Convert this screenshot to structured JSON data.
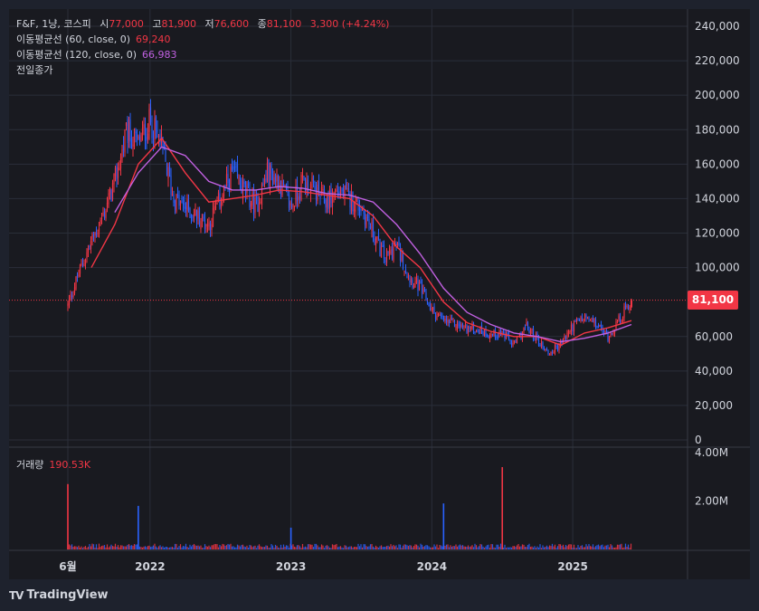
{
  "legend": {
    "symbol": "F&F, 1냥, 코스피",
    "open_label": "시",
    "open_value": "77,000",
    "high_label": "고",
    "high_value": "81,900",
    "low_label": "저",
    "low_value": "76,600",
    "close_label": "종",
    "close_value": "81,100",
    "change": "3,300 (+4.24%)",
    "ma60_label": "이동평균선 (60, close, 0)",
    "ma60_value": "69,240",
    "ma120_label": "이동평균선 (120, close, 0)",
    "ma120_value": "66,983",
    "prev_close_label": "전일종가"
  },
  "volume_legend": {
    "label": "거래량",
    "value": "190.53K"
  },
  "last_price_badge": "81,100",
  "brand": {
    "logo": "TV",
    "name": "TradingView"
  },
  "colors": {
    "background": "#1e222d",
    "pane": "#191a20",
    "grid": "#2a2e39",
    "up": "#f23645",
    "down": "#2962ff",
    "ma60": "#f23645",
    "ma120": "#c060e0",
    "text": "#d1d4dc"
  },
  "chart_data": {
    "type": "candlestick",
    "x_ticks": [
      "6월",
      "2022",
      "2023",
      "2024",
      "2025"
    ],
    "x_tick_dates": [
      "2021-06",
      "2022-01",
      "2023-01",
      "2024-01",
      "2025-01"
    ],
    "price_axis_ticks": [
      "240,000",
      "220,000",
      "200,000",
      "180,000",
      "160,000",
      "140,000",
      "120,000",
      "100,000",
      "60,000",
      "40,000",
      "20,000",
      "0"
    ],
    "price_tick_values": [
      240000,
      220000,
      200000,
      180000,
      160000,
      140000,
      120000,
      100000,
      60000,
      40000,
      20000,
      0
    ],
    "price_ylim": [
      0,
      245000
    ],
    "volume_axis_ticks": [
      "4.00M",
      "2.00M"
    ],
    "volume_tick_values": [
      4000000,
      2000000
    ],
    "volume_ylim": [
      0,
      4600000
    ],
    "last_close": 81100,
    "price_series": [
      [
        "2021-06",
        78000
      ],
      [
        "2021-07",
        98000
      ],
      [
        "2021-08",
        115000
      ],
      [
        "2021-09",
        130000
      ],
      [
        "2021-10",
        150000
      ],
      [
        "2021-11",
        178000
      ],
      [
        "2021-12",
        172000
      ],
      [
        "2022-01",
        185000
      ],
      [
        "2022-02",
        170000
      ],
      [
        "2022-03",
        140000
      ],
      [
        "2022-04",
        135000
      ],
      [
        "2022-05",
        130000
      ],
      [
        "2022-06",
        125000
      ],
      [
        "2022-07",
        140000
      ],
      [
        "2022-08",
        155000
      ],
      [
        "2022-09",
        145000
      ],
      [
        "2022-10",
        135000
      ],
      [
        "2022-11",
        155000
      ],
      [
        "2022-12",
        150000
      ],
      [
        "2023-01",
        135000
      ],
      [
        "2023-02",
        150000
      ],
      [
        "2023-03",
        145000
      ],
      [
        "2023-04",
        138000
      ],
      [
        "2023-05",
        145000
      ],
      [
        "2023-06",
        140000
      ],
      [
        "2023-07",
        135000
      ],
      [
        "2023-08",
        120000
      ],
      [
        "2023-09",
        105000
      ],
      [
        "2023-10",
        113000
      ],
      [
        "2023-11",
        95000
      ],
      [
        "2023-12",
        88000
      ],
      [
        "2024-01",
        75000
      ],
      [
        "2024-02",
        69000
      ],
      [
        "2024-03",
        67000
      ],
      [
        "2024-04",
        65000
      ],
      [
        "2024-05",
        64000
      ],
      [
        "2024-06",
        61000
      ],
      [
        "2024-07",
        62000
      ],
      [
        "2024-08",
        55000
      ],
      [
        "2024-09",
        66000
      ],
      [
        "2024-10",
        58000
      ],
      [
        "2024-11",
        50000
      ],
      [
        "2024-12",
        56000
      ],
      [
        "2025-01",
        66000
      ],
      [
        "2025-02",
        71000
      ],
      [
        "2025-03",
        67000
      ],
      [
        "2025-04",
        60000
      ],
      [
        "2025-05",
        70000
      ],
      [
        "2025-06",
        81100
      ]
    ],
    "ma60_series": [
      [
        "2021-08",
        100000
      ],
      [
        "2021-10",
        125000
      ],
      [
        "2021-12",
        160000
      ],
      [
        "2022-02",
        175000
      ],
      [
        "2022-04",
        155000
      ],
      [
        "2022-06",
        138000
      ],
      [
        "2022-08",
        140000
      ],
      [
        "2022-10",
        142000
      ],
      [
        "2022-12",
        145000
      ],
      [
        "2023-02",
        144000
      ],
      [
        "2023-04",
        142000
      ],
      [
        "2023-06",
        140000
      ],
      [
        "2023-08",
        130000
      ],
      [
        "2023-10",
        112000
      ],
      [
        "2023-12",
        100000
      ],
      [
        "2024-02",
        80000
      ],
      [
        "2024-04",
        68000
      ],
      [
        "2024-06",
        63000
      ],
      [
        "2024-08",
        60000
      ],
      [
        "2024-10",
        60000
      ],
      [
        "2024-12",
        55000
      ],
      [
        "2025-02",
        62000
      ],
      [
        "2025-04",
        65000
      ],
      [
        "2025-06",
        69240
      ]
    ],
    "ma120_series": [
      [
        "2021-10",
        132000
      ],
      [
        "2021-12",
        155000
      ],
      [
        "2022-02",
        170000
      ],
      [
        "2022-04",
        165000
      ],
      [
        "2022-06",
        150000
      ],
      [
        "2022-08",
        145000
      ],
      [
        "2022-10",
        145000
      ],
      [
        "2022-12",
        147000
      ],
      [
        "2023-02",
        146000
      ],
      [
        "2023-04",
        143000
      ],
      [
        "2023-06",
        142000
      ],
      [
        "2023-08",
        138000
      ],
      [
        "2023-10",
        125000
      ],
      [
        "2023-12",
        108000
      ],
      [
        "2024-02",
        88000
      ],
      [
        "2024-04",
        74000
      ],
      [
        "2024-06",
        67000
      ],
      [
        "2024-08",
        62000
      ],
      [
        "2024-10",
        60000
      ],
      [
        "2024-12",
        57000
      ],
      [
        "2025-02",
        59000
      ],
      [
        "2025-04",
        62000
      ],
      [
        "2025-06",
        66983
      ]
    ],
    "volume_spikes": [
      [
        "2021-06",
        2700000
      ],
      [
        "2021-12",
        1800000
      ],
      [
        "2023-01",
        900000
      ],
      [
        "2024-02",
        1900000
      ],
      [
        "2024-07",
        3400000
      ]
    ],
    "grid": true
  }
}
